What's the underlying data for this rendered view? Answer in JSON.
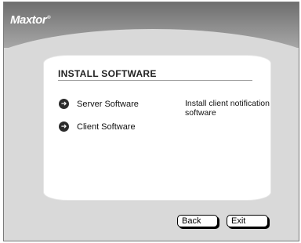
{
  "brand": {
    "logo_text": "Maxtor",
    "logo_mark": "®"
  },
  "panel": {
    "title": "INSTALL SOFTWARE",
    "options": [
      {
        "label": "Server Software",
        "icon": "arrow-right-circle-icon"
      },
      {
        "label": "Client Software",
        "icon": "arrow-right-circle-icon"
      }
    ],
    "description": "Install client notification software"
  },
  "buttons": {
    "back_label": "Back",
    "exit_label": "Exit"
  }
}
